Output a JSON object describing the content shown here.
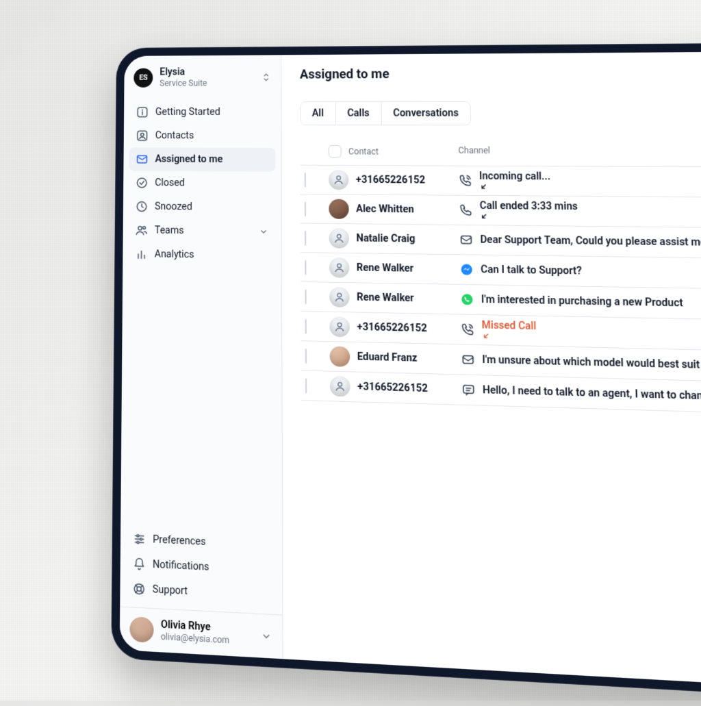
{
  "org": {
    "name": "Elysia",
    "sub": "Service Suite",
    "logo_text": "ES"
  },
  "sidebar": {
    "items": [
      {
        "label": "Getting Started",
        "icon": "info"
      },
      {
        "label": "Contacts",
        "icon": "users-square"
      },
      {
        "label": "Assigned to me",
        "icon": "mail",
        "active": true
      },
      {
        "label": "Closed",
        "icon": "check-circle"
      },
      {
        "label": "Snoozed",
        "icon": "clock"
      },
      {
        "label": "Teams",
        "icon": "users",
        "chevron": true
      },
      {
        "label": "Analytics",
        "icon": "bar-chart"
      }
    ],
    "footer_items": [
      {
        "label": "Preferences",
        "icon": "sliders"
      },
      {
        "label": "Notifications",
        "icon": "bell"
      },
      {
        "label": "Support",
        "icon": "life-buoy"
      }
    ]
  },
  "user": {
    "name": "Olivia Rhye",
    "email": "olivia@elysia.com"
  },
  "page": {
    "title": "Assigned to me",
    "tabs": [
      "All",
      "Calls",
      "Conversations"
    ],
    "columns": {
      "contact": "Contact",
      "channel": "Channel"
    },
    "rows": [
      {
        "contact": "+31665226152",
        "avatar": "gray",
        "channel": "phone-incoming",
        "message": "Incoming call...",
        "arrow": true
      },
      {
        "contact": "Alec Whitten",
        "avatar": "photo",
        "channel": "phone",
        "message": "Call ended 3:33 mins",
        "arrow": true
      },
      {
        "contact": "Natalie Craig",
        "avatar": "gray",
        "channel": "email",
        "message": "Dear Support Team, Could you please assist me in resolving this issue"
      },
      {
        "contact": "Rene Walker",
        "avatar": "gray",
        "channel": "messenger",
        "message": "Can I talk to Support?"
      },
      {
        "contact": "Rene Walker",
        "avatar": "gray",
        "channel": "whatsapp",
        "message": "I'm interested in purchasing a new Product"
      },
      {
        "contact": "+31665226152",
        "avatar": "gray",
        "channel": "phone-incoming",
        "message": "Missed Call",
        "arrow": true,
        "missed": true
      },
      {
        "contact": "Eduard Franz",
        "avatar": "photo2",
        "channel": "email",
        "message": "I'm unsure about which model would best suit my needs. Could you p"
      },
      {
        "contact": "+31665226152",
        "avatar": "gray",
        "channel": "chat",
        "message": "Hello, I need to talk to an agent, I want to change my payment metho"
      }
    ]
  }
}
